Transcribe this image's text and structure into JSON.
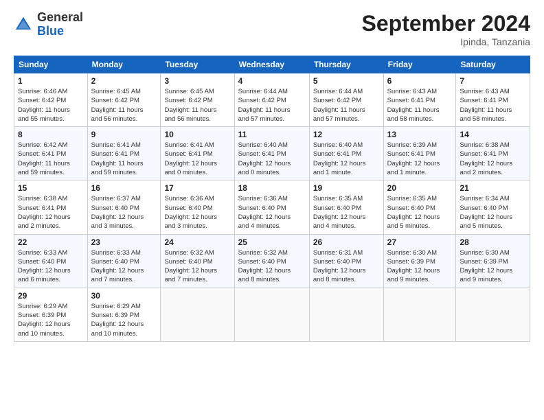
{
  "header": {
    "logo": {
      "general": "General",
      "blue": "Blue"
    },
    "title": "September 2024",
    "location": "Ipinda, Tanzania"
  },
  "calendar": {
    "days_of_week": [
      "Sunday",
      "Monday",
      "Tuesday",
      "Wednesday",
      "Thursday",
      "Friday",
      "Saturday"
    ],
    "weeks": [
      [
        {
          "day": "",
          "info": ""
        },
        {
          "day": "",
          "info": ""
        },
        {
          "day": "",
          "info": ""
        },
        {
          "day": "",
          "info": ""
        },
        {
          "day": "5",
          "info": "Sunrise: 6:44 AM\nSunset: 6:42 PM\nDaylight: 11 hours\nand 57 minutes."
        },
        {
          "day": "6",
          "info": "Sunrise: 6:43 AM\nSunset: 6:41 PM\nDaylight: 11 hours\nand 58 minutes."
        },
        {
          "day": "7",
          "info": "Sunrise: 6:43 AM\nSunset: 6:41 PM\nDaylight: 11 hours\nand 58 minutes."
        }
      ],
      [
        {
          "day": "1",
          "info": "Sunrise: 6:46 AM\nSunset: 6:42 PM\nDaylight: 11 hours\nand 55 minutes."
        },
        {
          "day": "2",
          "info": "Sunrise: 6:45 AM\nSunset: 6:42 PM\nDaylight: 11 hours\nand 56 minutes."
        },
        {
          "day": "3",
          "info": "Sunrise: 6:45 AM\nSunset: 6:42 PM\nDaylight: 11 hours\nand 56 minutes."
        },
        {
          "day": "4",
          "info": "Sunrise: 6:44 AM\nSunset: 6:42 PM\nDaylight: 11 hours\nand 57 minutes."
        },
        {
          "day": "5",
          "info": "Sunrise: 6:44 AM\nSunset: 6:42 PM\nDaylight: 11 hours\nand 57 minutes."
        },
        {
          "day": "6",
          "info": "Sunrise: 6:43 AM\nSunset: 6:41 PM\nDaylight: 11 hours\nand 58 minutes."
        },
        {
          "day": "7",
          "info": "Sunrise: 6:43 AM\nSunset: 6:41 PM\nDaylight: 11 hours\nand 58 minutes."
        }
      ],
      [
        {
          "day": "8",
          "info": "Sunrise: 6:42 AM\nSunset: 6:41 PM\nDaylight: 11 hours\nand 59 minutes."
        },
        {
          "day": "9",
          "info": "Sunrise: 6:41 AM\nSunset: 6:41 PM\nDaylight: 11 hours\nand 59 minutes."
        },
        {
          "day": "10",
          "info": "Sunrise: 6:41 AM\nSunset: 6:41 PM\nDaylight: 12 hours\nand 0 minutes."
        },
        {
          "day": "11",
          "info": "Sunrise: 6:40 AM\nSunset: 6:41 PM\nDaylight: 12 hours\nand 0 minutes."
        },
        {
          "day": "12",
          "info": "Sunrise: 6:40 AM\nSunset: 6:41 PM\nDaylight: 12 hours\nand 1 minute."
        },
        {
          "day": "13",
          "info": "Sunrise: 6:39 AM\nSunset: 6:41 PM\nDaylight: 12 hours\nand 1 minute."
        },
        {
          "day": "14",
          "info": "Sunrise: 6:38 AM\nSunset: 6:41 PM\nDaylight: 12 hours\nand 2 minutes."
        }
      ],
      [
        {
          "day": "15",
          "info": "Sunrise: 6:38 AM\nSunset: 6:41 PM\nDaylight: 12 hours\nand 2 minutes."
        },
        {
          "day": "16",
          "info": "Sunrise: 6:37 AM\nSunset: 6:40 PM\nDaylight: 12 hours\nand 3 minutes."
        },
        {
          "day": "17",
          "info": "Sunrise: 6:36 AM\nSunset: 6:40 PM\nDaylight: 12 hours\nand 3 minutes."
        },
        {
          "day": "18",
          "info": "Sunrise: 6:36 AM\nSunset: 6:40 PM\nDaylight: 12 hours\nand 4 minutes."
        },
        {
          "day": "19",
          "info": "Sunrise: 6:35 AM\nSunset: 6:40 PM\nDaylight: 12 hours\nand 4 minutes."
        },
        {
          "day": "20",
          "info": "Sunrise: 6:35 AM\nSunset: 6:40 PM\nDaylight: 12 hours\nand 5 minutes."
        },
        {
          "day": "21",
          "info": "Sunrise: 6:34 AM\nSunset: 6:40 PM\nDaylight: 12 hours\nand 5 minutes."
        }
      ],
      [
        {
          "day": "22",
          "info": "Sunrise: 6:33 AM\nSunset: 6:40 PM\nDaylight: 12 hours\nand 6 minutes."
        },
        {
          "day": "23",
          "info": "Sunrise: 6:33 AM\nSunset: 6:40 PM\nDaylight: 12 hours\nand 7 minutes."
        },
        {
          "day": "24",
          "info": "Sunrise: 6:32 AM\nSunset: 6:40 PM\nDaylight: 12 hours\nand 7 minutes."
        },
        {
          "day": "25",
          "info": "Sunrise: 6:32 AM\nSunset: 6:40 PM\nDaylight: 12 hours\nand 8 minutes."
        },
        {
          "day": "26",
          "info": "Sunrise: 6:31 AM\nSunset: 6:40 PM\nDaylight: 12 hours\nand 8 minutes."
        },
        {
          "day": "27",
          "info": "Sunrise: 6:30 AM\nSunset: 6:39 PM\nDaylight: 12 hours\nand 9 minutes."
        },
        {
          "day": "28",
          "info": "Sunrise: 6:30 AM\nSunset: 6:39 PM\nDaylight: 12 hours\nand 9 minutes."
        }
      ],
      [
        {
          "day": "29",
          "info": "Sunrise: 6:29 AM\nSunset: 6:39 PM\nDaylight: 12 hours\nand 10 minutes."
        },
        {
          "day": "30",
          "info": "Sunrise: 6:29 AM\nSunset: 6:39 PM\nDaylight: 12 hours\nand 10 minutes."
        },
        {
          "day": "",
          "info": ""
        },
        {
          "day": "",
          "info": ""
        },
        {
          "day": "",
          "info": ""
        },
        {
          "day": "",
          "info": ""
        },
        {
          "day": "",
          "info": ""
        }
      ]
    ]
  }
}
